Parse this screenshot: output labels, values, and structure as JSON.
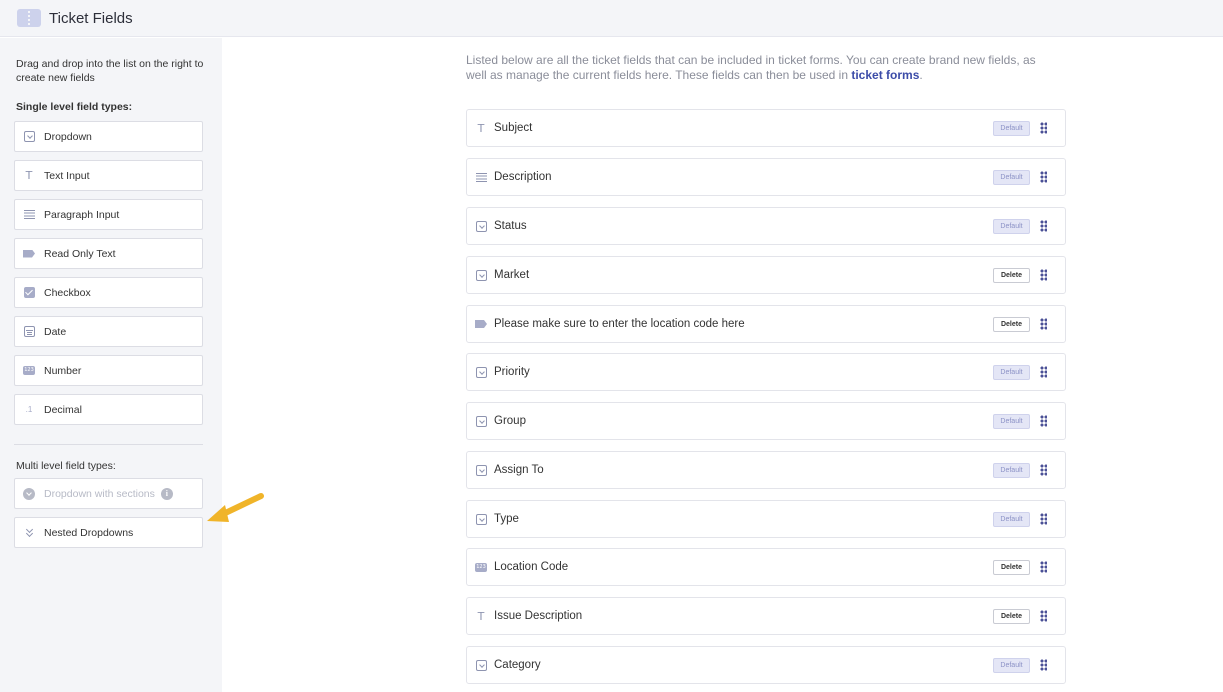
{
  "header": {
    "title": "Ticket Fields",
    "icon": "ticket-icon"
  },
  "sidebar": {
    "intro": "Drag and drop into the list on the right to create new fields",
    "single_title": "Single level field types:",
    "single_types": [
      {
        "label": "Dropdown",
        "icon": "dropdown-icon"
      },
      {
        "label": "Text Input",
        "icon": "text-icon"
      },
      {
        "label": "Paragraph Input",
        "icon": "paragraph-icon"
      },
      {
        "label": "Read Only Text",
        "icon": "read-only-icon"
      },
      {
        "label": "Checkbox",
        "icon": "checkbox-icon"
      },
      {
        "label": "Date",
        "icon": "date-icon"
      },
      {
        "label": "Number",
        "icon": "number-icon",
        "icon_text": "123"
      },
      {
        "label": "Decimal",
        "icon": "decimal-icon",
        "icon_text": ".1"
      }
    ],
    "multi_title": "Multi level field types:",
    "multi_types": [
      {
        "label": "Dropdown with sections",
        "icon": "dropdown-sections-icon",
        "disabled": true,
        "info": "i"
      },
      {
        "label": "Nested Dropdowns",
        "icon": "nested-dropdown-icon"
      }
    ]
  },
  "main": {
    "description": "Listed below are all the ticket fields that can be included in ticket forms. You can create brand new fields, as well as manage the current fields here. These fields can then be used in ",
    "description_link": "ticket forms",
    "description_end": ".",
    "fields": [
      {
        "label": "Subject",
        "icon": "text-icon",
        "tag": "Default"
      },
      {
        "label": "Description",
        "icon": "paragraph-icon",
        "tag": "Default"
      },
      {
        "label": "Status",
        "icon": "dropdown-icon",
        "tag": "Default"
      },
      {
        "label": "Market",
        "icon": "dropdown-icon",
        "tag": "Delete"
      },
      {
        "label": "Please make sure to enter the location code here",
        "icon": "read-only-icon",
        "tag": "Delete"
      },
      {
        "label": "Priority",
        "icon": "dropdown-icon",
        "tag": "Default"
      },
      {
        "label": "Group",
        "icon": "dropdown-icon",
        "tag": "Default"
      },
      {
        "label": "Assign To",
        "icon": "dropdown-icon",
        "tag": "Default"
      },
      {
        "label": "Type",
        "icon": "dropdown-icon",
        "tag": "Default"
      },
      {
        "label": "Location Code",
        "icon": "number-icon",
        "tag": "Delete"
      },
      {
        "label": "Issue Description",
        "icon": "text-icon",
        "tag": "Delete"
      },
      {
        "label": "Category",
        "icon": "dropdown-icon",
        "tag": "Default"
      }
    ]
  },
  "colors": {
    "accent": "#3c4ca8",
    "arrow": "#f0b429",
    "sidebar_bg": "#f4f5f8"
  }
}
